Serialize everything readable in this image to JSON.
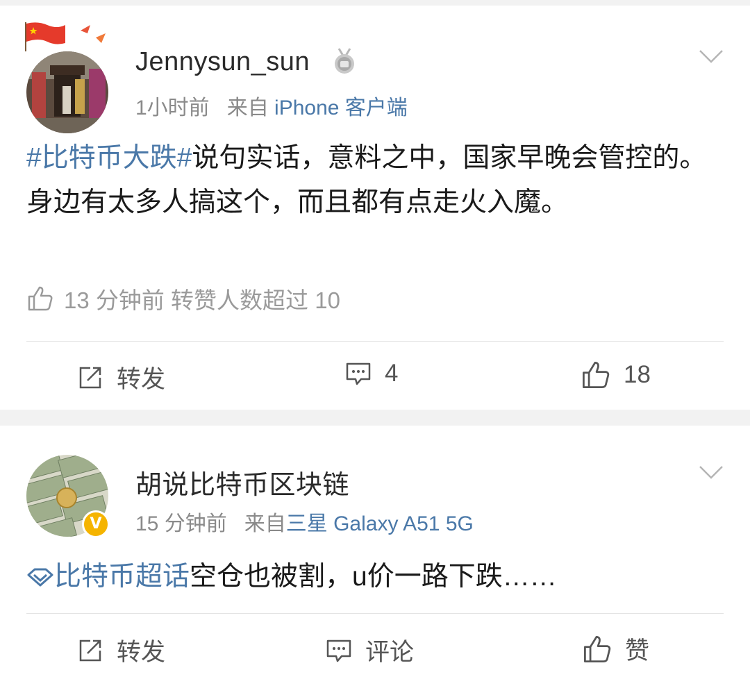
{
  "posts": [
    {
      "username": "Jennysun_sun",
      "time": "1小时前",
      "from_prefix": "来自",
      "source": "iPhone 客户端",
      "hashtag": "#比特币大跌#",
      "text": "说句实话，意料之中，国家早晚会管控的。身边有太多人搞这个，而且都有点走火入魔。",
      "like_info": "13 分钟前 转赞人数超过 10",
      "actions": {
        "repost": "转发",
        "comments": "4",
        "likes": "18"
      }
    },
    {
      "username": "胡说比特币区块链",
      "time": "15 分钟前",
      "from_prefix": "来自",
      "source": "三星 Galaxy A51 5G",
      "supertopic": "比特币超话",
      "text": "空仓也被割，u价一路下跌……",
      "verified_mark": "V",
      "actions": {
        "repost": "转发",
        "comment": "评论",
        "like": "赞"
      }
    }
  ],
  "colors": {
    "link": "#4a78a8",
    "meta": "#8a8a8a",
    "verified": "#f5b400"
  },
  "icons": [
    "china-flag-icon",
    "medal-badge-icon",
    "chevron-down-icon",
    "thumbs-up-icon",
    "repost-icon",
    "comment-icon",
    "supertopic-diamond-icon",
    "verified-badge-icon"
  ]
}
